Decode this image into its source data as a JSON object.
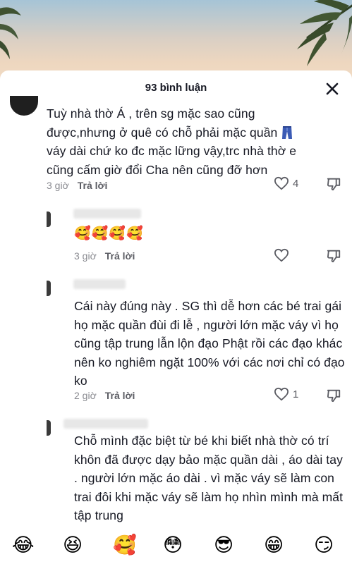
{
  "header": {
    "title": "93 bình luận"
  },
  "comments": [
    {
      "text_a": "Tuỳ nhà thờ Á , trên sg mặc sao cũng được,nhưng ở quê có chỗ phải mặc quần ",
      "text_b": " váy dài chứ ko đc mặc lững vậy,trc nhà thờ e cũng cấm giờ đổi Cha nên cũng đỡ hơn",
      "time": "3 giờ",
      "reply": "Trả lời",
      "likes": "4"
    },
    {
      "emojis": "🥰🥰🥰🥰",
      "time": "3 giờ",
      "reply": "Trả lời",
      "likes": ""
    },
    {
      "text": "Cái này đúng này . SG thì dễ hơn các bé trai gái họ mặc quần đùi đi lễ , người lớn mặc váy vì họ cũng tập trung lẫn lộn đạo Phật rồi các đạo khác nên ko nghiêm ngặt 100% với các nơi chỉ có đạo ko",
      "time": "2 giờ",
      "reply": "Trả lời",
      "likes": "1"
    },
    {
      "text": "Chỗ mình đặc biệt từ bé khi biết nhà thờ có trí khôn đã được dạy bảo mặc quần dài , áo dài tay . người lớn mặc áo dài . vì mặc váy sẽ làm con trai đôi khi mặc váy sẽ làm họ nhìn mình mà mất tập trung"
    }
  ],
  "emoji_bar": [
    "😂",
    "😆",
    "🥰",
    "😳",
    "😎",
    "😁",
    "😏"
  ],
  "icons": {
    "close": "close-icon",
    "like": "heart-outline-icon",
    "dislike": "thumbs-down-icon",
    "jeans": "jeans-icon"
  }
}
